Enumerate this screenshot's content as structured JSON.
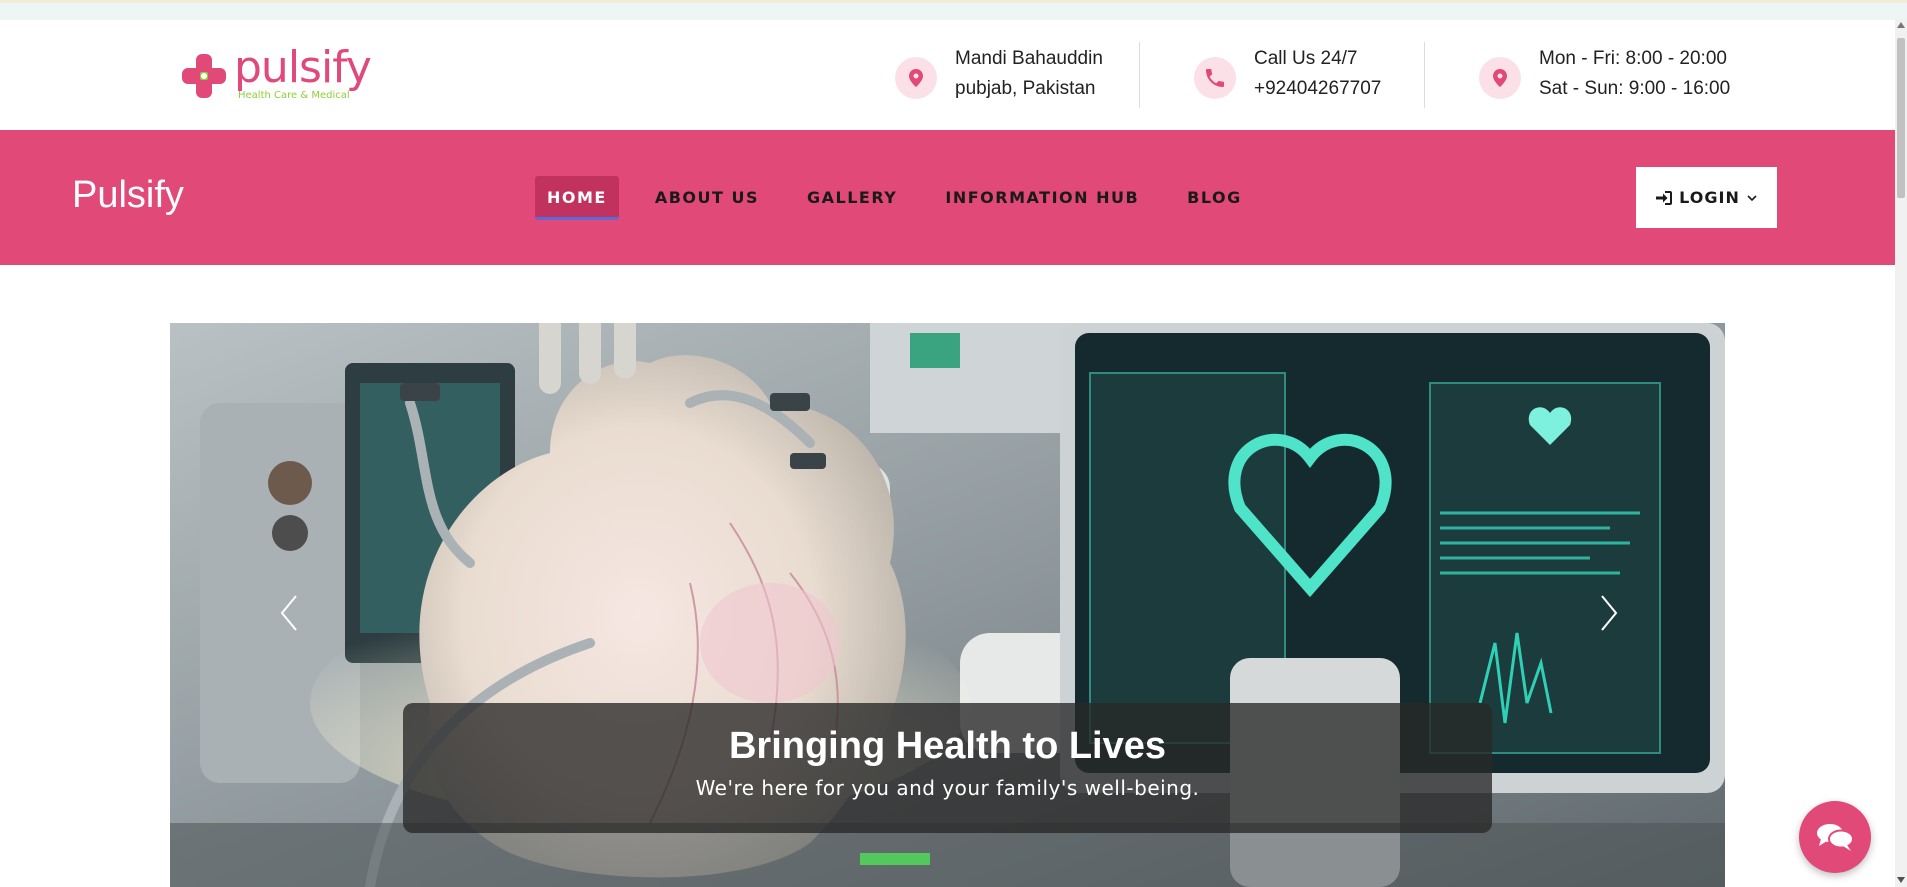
{
  "brand": {
    "logo_word": "pulsify",
    "logo_tagline": "Health Care & Medical",
    "navbar_title": "Pulsify"
  },
  "header_info": {
    "location": {
      "icon": "location-pin-icon",
      "line1": "Mandi Bahauddin",
      "line2": "pubjab, Pakistan"
    },
    "phone": {
      "icon": "phone-icon",
      "line1": "Call Us 24/7",
      "line2": "+92404267707"
    },
    "hours": {
      "icon": "location-pin-icon",
      "line1": "Mon - Fri: 8:00 - 20:00",
      "line2": "Sat - Sun: 9:00 - 16:00"
    }
  },
  "nav": {
    "items": [
      {
        "label": "HOME",
        "active": true
      },
      {
        "label": "ABOUT US",
        "active": false
      },
      {
        "label": "GALLERY",
        "active": false
      },
      {
        "label": "INFORMATION HUB",
        "active": false
      },
      {
        "label": "BLOG",
        "active": false
      }
    ],
    "login_label": "LOGIN"
  },
  "hero": {
    "title": "Bringing Health to Lives",
    "subtitle": "We're here for you and your family's well-being."
  },
  "colors": {
    "brand_pink": "#e04978",
    "active_nav": "#c2325e",
    "tagline_green": "#8fce3a",
    "icon_circle": "#fbe0e7"
  }
}
